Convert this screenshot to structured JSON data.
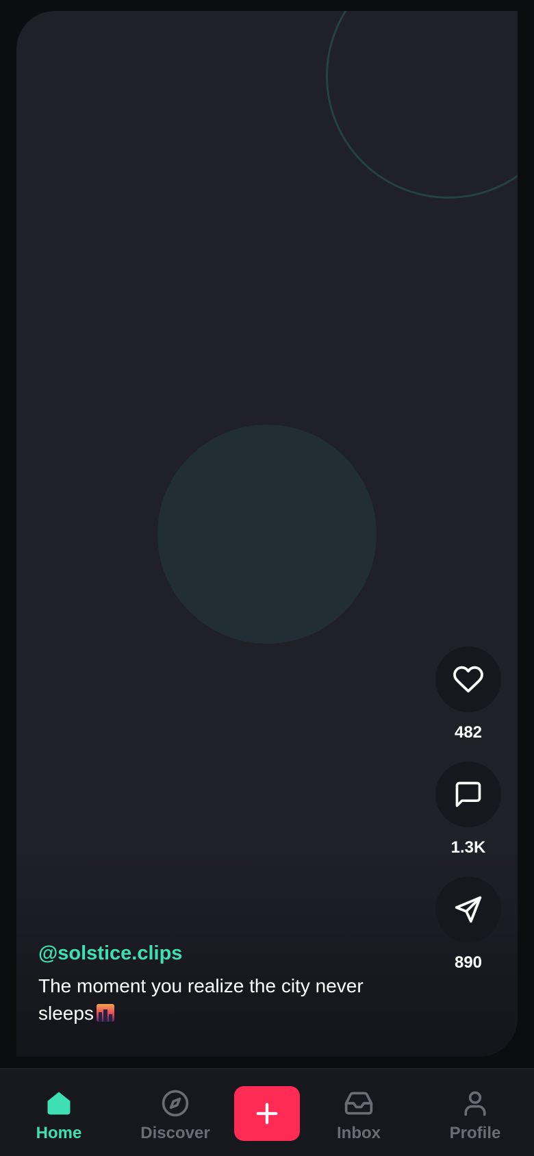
{
  "post": {
    "handle": "@solstice.clips",
    "caption": "The moment you realize the city never sleeps",
    "caption_emoji": "city-sunset-emoji"
  },
  "actions": {
    "like": {
      "icon": "heart-icon",
      "count": "482"
    },
    "comment": {
      "icon": "comment-icon",
      "count": "1.3K"
    },
    "share": {
      "icon": "send-icon",
      "count": "890"
    }
  },
  "nav": {
    "active": "home",
    "accent_color": "#3ee0b3",
    "create_color": "#fe2c55",
    "items": [
      {
        "key": "home",
        "label": "Home",
        "icon": "home-icon"
      },
      {
        "key": "discover",
        "label": "Discover",
        "icon": "compass-icon"
      },
      {
        "key": "create",
        "label": "",
        "icon": "plus-icon"
      },
      {
        "key": "inbox",
        "label": "Inbox",
        "icon": "inbox-icon"
      },
      {
        "key": "profile",
        "label": "Profile",
        "icon": "profile-icon"
      }
    ]
  }
}
